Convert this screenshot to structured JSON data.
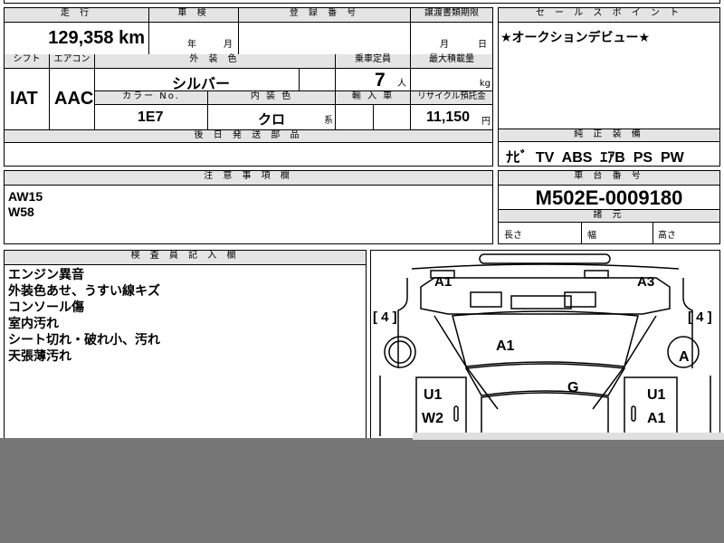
{
  "top": {
    "mileage_label": "走 行",
    "mileage_value": "129,358 km",
    "shaken_label": "車 検",
    "shaken_year": "年",
    "shaken_month": "月",
    "reg_label": "登 録 番 号",
    "transfer_label": "譲渡書類期限",
    "transfer_month": "月",
    "transfer_day": "日"
  },
  "specs": {
    "shift_label": "シフト",
    "shift_value": "IAT",
    "ac_label": "エアコン",
    "ac_value": "AAC",
    "color_label": "外 装 色",
    "color_value": "シルバー",
    "capacity_label": "乗車定員",
    "capacity_value": "7",
    "capacity_unit": "人",
    "load_label": "最大積載量",
    "load_unit": "kg",
    "color_no_label": "カラー No.",
    "color_no_value": "1E7",
    "interior_label": "内 装 色",
    "interior_value": "クロ",
    "interior_suffix": "系",
    "import_label": "輸 入 車",
    "recycle_label": "リサイクル預託金",
    "recycle_value": "11,150",
    "recycle_unit": "円",
    "later_parts_label": "後 日 発 送 部 品"
  },
  "sales_point": {
    "label": "セ ー ル ス ポ イ ン ト",
    "text": "★オークションデビュー★"
  },
  "equipment": {
    "label": "純 正 装 備",
    "value": "ﾅﾋﾞ  TV  ABS  ｴｱB  PS  PW"
  },
  "notes": {
    "label": "注 意 事 項 欄",
    "lines": [
      "AW15",
      "W58"
    ]
  },
  "chassis": {
    "label": "車 台 番 号",
    "value": "M502E-0009180",
    "specs_label": "諸 元",
    "length_label": "長さ",
    "width_label": "幅",
    "height_label": "高さ"
  },
  "inspector": {
    "label": "検 査 員 記 入 欄",
    "lines": [
      "エンジン異音",
      "外装色あせ、うすい線キズ",
      "コンソール傷",
      "室内汚れ",
      "シート切れ・破れ小、汚れ",
      "天張薄汚れ"
    ]
  },
  "diagram": {
    "marks": {
      "front_left": "A1",
      "front_right": "A3",
      "left_4": "[ 4 ]",
      "right_4": "[ 4 ]",
      "hood": "A1",
      "right_wheel": "A",
      "roof": "G",
      "left_door_1": "U1",
      "left_door_2": "W2",
      "right_door_1": "U1",
      "right_door_2": "A1"
    }
  },
  "colors": {
    "header_bg": "#e4e4e4",
    "overlay_gray": "#777777"
  }
}
